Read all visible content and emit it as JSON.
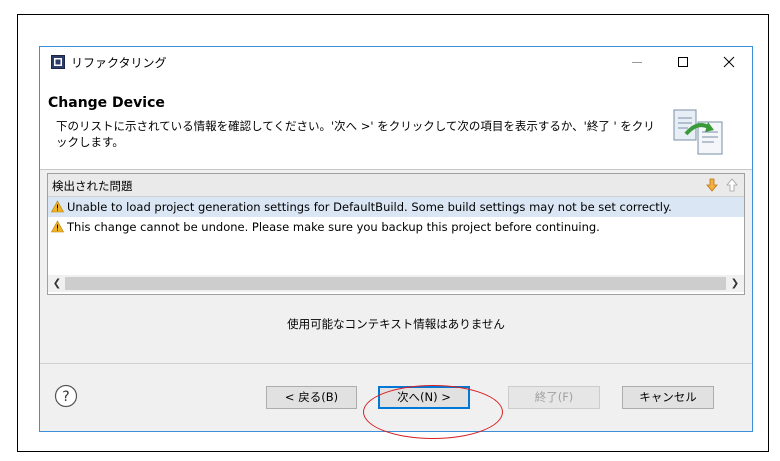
{
  "window": {
    "title": "リファクタリング",
    "minimize_glyph": "—",
    "maximize_glyph": "☐",
    "close_glyph": "✕"
  },
  "header": {
    "title": "Change Device",
    "description": "下のリストに示されている情報を確認してください。'次へ >' をクリックして次の項目を表示するか、'終了 ' をクリックします。",
    "icon": "refactor-wizard-icon"
  },
  "problems": {
    "title": "検出された問題",
    "next_icon": "arrow-down-icon",
    "prev_icon": "arrow-up-icon",
    "items": [
      {
        "severity": "warning",
        "text": "Unable to load project generation settings for DefaultBuild. Some build settings may not be set correctly."
      },
      {
        "severity": "warning",
        "text": "This change cannot be undone. Please make sure you backup this project before continuing."
      }
    ]
  },
  "context_message": "使用可能なコンテキスト情報はありません",
  "buttons": {
    "help_glyph": "?",
    "back": "< 戻る(B)",
    "next": "次へ(N) >",
    "finish": "終了(F)",
    "cancel": "キャンセル"
  },
  "colors": {
    "dialog_border": "#3c8fd8",
    "selected_row": "#dbe6f4",
    "warning": "#e8a317",
    "annotation": "#d62020"
  }
}
